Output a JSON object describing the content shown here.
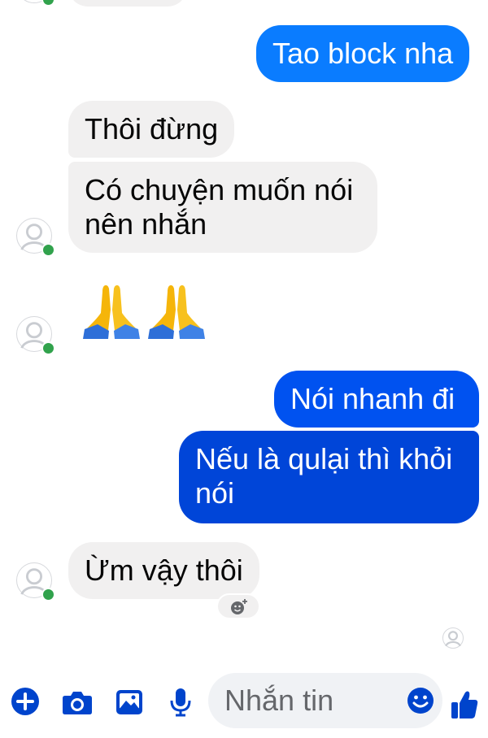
{
  "colors": {
    "outgoing_bubble": "#0a7cff",
    "outgoing_bubble_deep": "#0045d8",
    "incoming_bubble": "#f1f0f0",
    "accent": "#0044cc",
    "online_dot": "#31a24c"
  },
  "messages": [
    {
      "from": "me",
      "text": "Tao block nha"
    },
    {
      "from": "them",
      "text": "Thôi đừng"
    },
    {
      "from": "them",
      "text": "Có chuyện muốn nói nên nhắn"
    },
    {
      "from": "them",
      "emoji": "folded-hands-x2"
    },
    {
      "from": "me",
      "text": "Nói nhanh đi"
    },
    {
      "from": "me",
      "text": "Nếu là qulại thì khỏi nói"
    },
    {
      "from": "them",
      "text": "Ừm vậy thôi"
    }
  ],
  "composer": {
    "placeholder": "Nhắn tin",
    "icons": [
      "plus-icon",
      "camera-icon",
      "image-icon",
      "microphone-icon",
      "emoji-icon",
      "thumbs-up-icon"
    ]
  }
}
